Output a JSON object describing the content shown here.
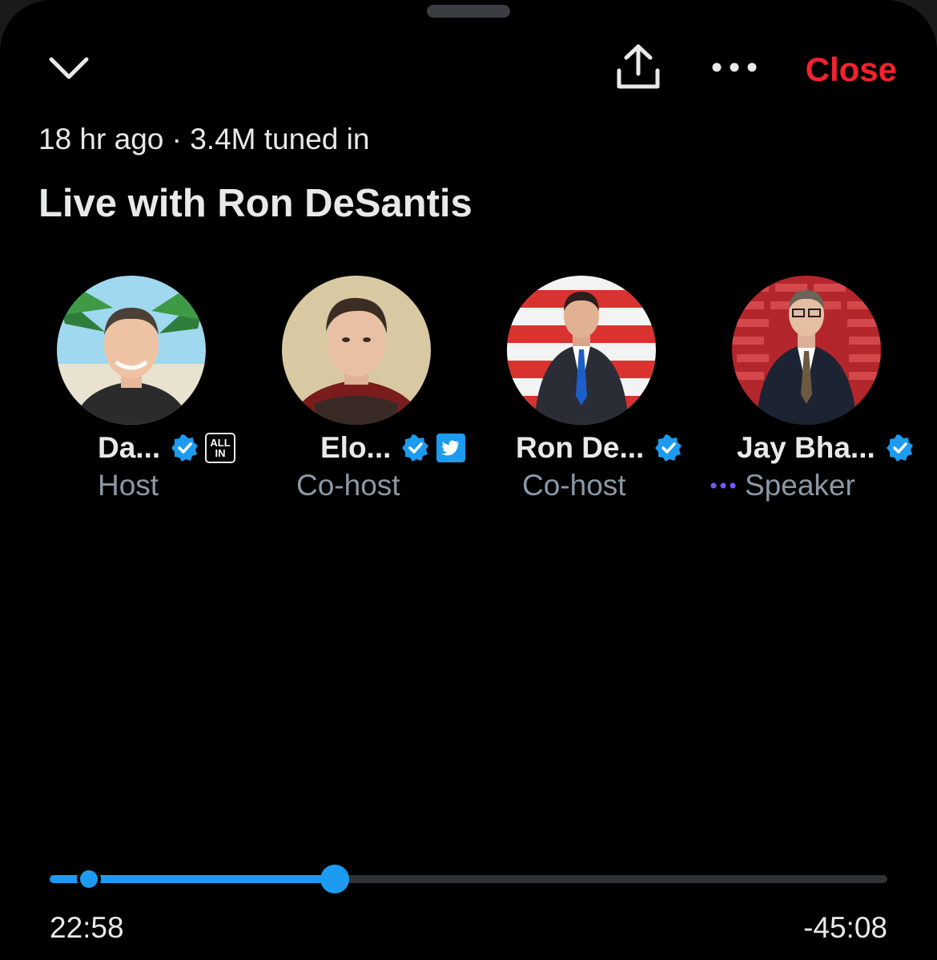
{
  "header": {
    "close_label": "Close",
    "icons": [
      "chevron-down-icon",
      "share-icon",
      "more-icon"
    ]
  },
  "space": {
    "meta": "18 hr ago · 3.4M tuned in",
    "title": "Live with Ron DeSantis"
  },
  "speakers": [
    {
      "name": "Da...",
      "role": "Host",
      "verified": true,
      "affiliate_badge": "ALL IN"
    },
    {
      "name": "Elo...",
      "role": "Co-host",
      "verified": true,
      "affiliate_badge": "twitter-bird-icon"
    },
    {
      "name": "Ron De...",
      "role": "Co-host",
      "verified": true
    },
    {
      "name": "Jay Bha...",
      "role": "Speaker",
      "verified": true,
      "speaking": true
    }
  ],
  "playback": {
    "elapsed": "22:58",
    "remaining": "-45:08",
    "progress_fraction": 0.34,
    "marker_fraction": 0.046
  },
  "colors": {
    "background": "#000000",
    "accent": "#1d9bf0",
    "close": "#f4212e",
    "text": "#e7e9ea",
    "secondary_text": "#8b98a5",
    "speaking_dots": "#7856ff"
  }
}
